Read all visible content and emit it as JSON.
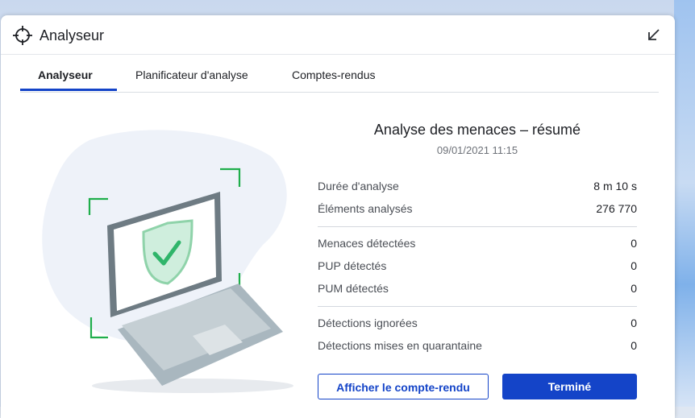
{
  "window": {
    "title": "Analyseur",
    "icon": "crosshair-icon",
    "collapse_icon": "collapse-arrow-icon"
  },
  "tabs": [
    {
      "label": "Analyseur",
      "active": true
    },
    {
      "label": "Planificateur d'analyse",
      "active": false
    },
    {
      "label": "Comptes-rendus",
      "active": false
    }
  ],
  "summary": {
    "title": "Analyse des menaces – résumé",
    "date": "09/01/2021 11:15",
    "groups": [
      [
        {
          "label": "Durée d'analyse",
          "value": "8 m 10 s"
        },
        {
          "label": "Éléments analysés",
          "value": "276 770"
        }
      ],
      [
        {
          "label": "Menaces détectées",
          "value": "0"
        },
        {
          "label": "PUP détectés",
          "value": "0"
        },
        {
          "label": "PUM détectés",
          "value": "0"
        }
      ],
      [
        {
          "label": "Détections ignorées",
          "value": "0"
        },
        {
          "label": "Détections mises en quarantaine",
          "value": "0"
        }
      ]
    ]
  },
  "buttons": {
    "view_report": "Afficher le compte-rendu",
    "done": "Terminé"
  },
  "colors": {
    "accent": "#1444c8",
    "check_green": "#2fb56a",
    "frame_green": "#1fae4b"
  },
  "illustration_icons": [
    "laptop-icon",
    "shield-check-icon"
  ]
}
